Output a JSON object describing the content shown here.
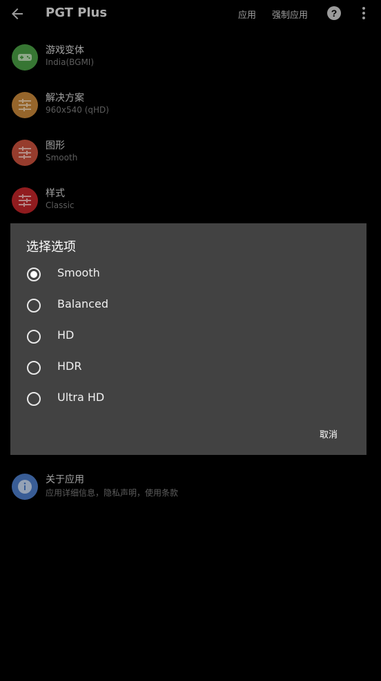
{
  "app_bar": {
    "title": "PGT Plus",
    "apply_label": "应用",
    "force_apply_label": "强制应用"
  },
  "settings": [
    {
      "label": "游戏变体",
      "value": "India(BGMI)",
      "icon": "gamepad-icon",
      "color": "#4a9e45"
    },
    {
      "label": "解决方案",
      "value": "960x540 (qHD)",
      "icon": "sliders-icon",
      "color": "#c7873a"
    },
    {
      "label": "图形",
      "value": "Smooth",
      "icon": "sliders-icon",
      "color": "#c9513c"
    },
    {
      "label": "样式",
      "value": "Classic",
      "icon": "sliders-icon",
      "color": "#c2262a"
    },
    {
      "label": "关于应用",
      "value": "应用详细信息，隐私声明，使用条款",
      "icon": "info-icon",
      "color": "#4d7cc9"
    }
  ],
  "dialog": {
    "title": "选择选项",
    "options": [
      "Smooth",
      "Balanced",
      "HD",
      "HDR",
      "Ultra HD"
    ],
    "selected": "Smooth",
    "cancel_label": "取消"
  },
  "colors": {
    "background": "#000000",
    "dialog_bg": "#424242",
    "overlay": "rgba(0,0,0,0.25)"
  }
}
